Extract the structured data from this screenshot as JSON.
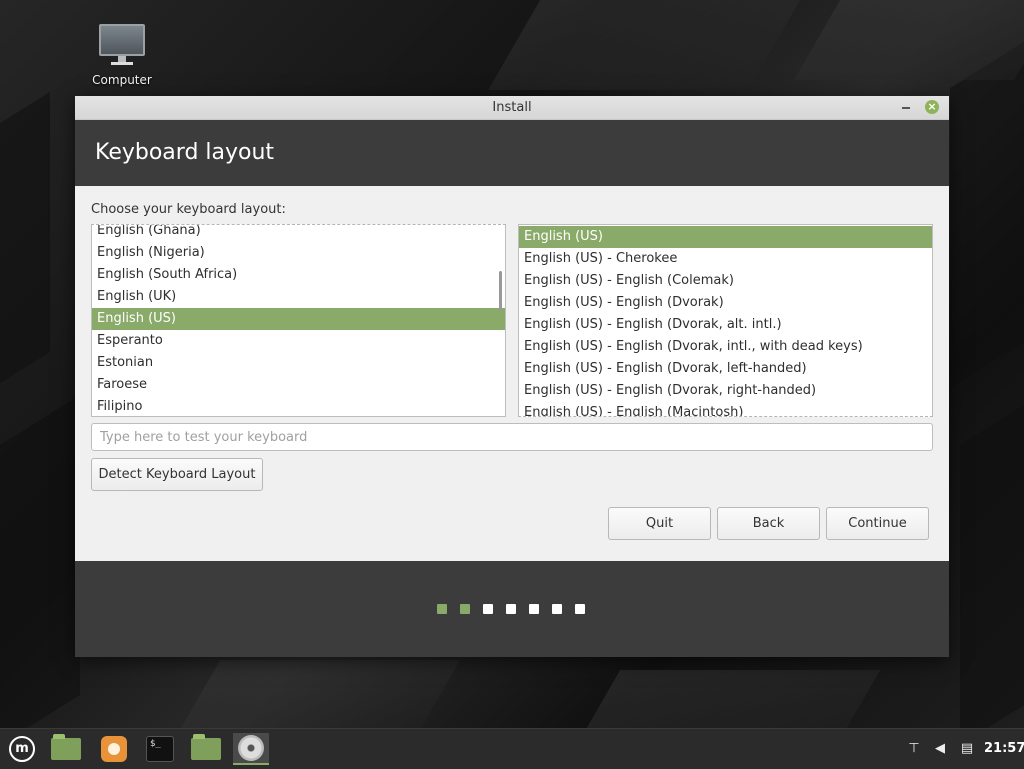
{
  "desktop": {
    "icon_label": "Computer"
  },
  "window": {
    "title": "Install",
    "minimize_icon": "minimize-icon",
    "close_icon": "close-icon"
  },
  "header": {
    "title": "Keyboard layout"
  },
  "content": {
    "prompt": "Choose your keyboard layout:",
    "layouts": [
      "English (Ghana)",
      "English (Nigeria)",
      "English (South Africa)",
      "English (UK)",
      "English (US)",
      "Esperanto",
      "Estonian",
      "Faroese",
      "Filipino"
    ],
    "selected_layout": "English (US)",
    "variants": [
      "English (US)",
      "English (US) - Cherokee",
      "English (US) - English (Colemak)",
      "English (US) - English (Dvorak)",
      "English (US) - English (Dvorak, alt. intl.)",
      "English (US) - English (Dvorak, intl., with dead keys)",
      "English (US) - English (Dvorak, left-handed)",
      "English (US) - English (Dvorak, right-handed)",
      "English (US) - English (Macintosh)"
    ],
    "selected_variant": "English (US)",
    "test_placeholder": "Type here to test your keyboard",
    "detect_label": "Detect Keyboard Layout"
  },
  "buttons": {
    "quit": "Quit",
    "back": "Back",
    "continue": "Continue"
  },
  "progress": {
    "total_steps": 7,
    "completed_steps": 2,
    "colors": {
      "done": "#8aaa6a",
      "todo": "#ffffff"
    }
  },
  "taskbar": {
    "items": [
      "mint-menu-icon",
      "files-icon",
      "firefox-icon",
      "terminal-icon",
      "folder-icon",
      "installer-disc-icon"
    ],
    "tray": [
      "network-icon",
      "volume-icon",
      "clipboard-icon"
    ],
    "clock": "21:57"
  },
  "colors": {
    "accent": "#8aaa6a",
    "header_bg": "#3c3c3c"
  }
}
